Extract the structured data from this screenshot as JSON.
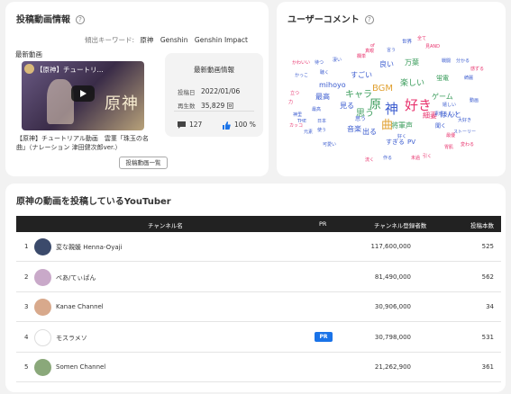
{
  "info": {
    "title": "投稿動画情報",
    "keywords_label": "傾出キーワード:",
    "keywords": [
      "原神",
      "Genshin",
      "Genshin Impact"
    ],
    "latest_label": "最新動画",
    "thumb_title": "【原神】チュートリ...",
    "thumb_logo": "原神",
    "video_title": "【原神】チュートリアル動画　雲菫「珠玉の名曲」（ナレーション 津田健次郎ver.）",
    "stats_title": "最新動画情報",
    "post_date_label": "投稿日",
    "post_date": "2022/01/06",
    "views_label": "再生数",
    "views": "35,829 回",
    "comments": "127",
    "like_ratio": "100 %",
    "list_button": "投稿動画一覧"
  },
  "cloud": {
    "title": "ユーザーコメント",
    "words": [
      {
        "t": "好き",
        "c": "#e8336d",
        "s": 15
      },
      {
        "t": "神",
        "c": "#3a5bcf",
        "s": 15
      },
      {
        "t": "原",
        "c": "#3a9c5b",
        "s": 13
      },
      {
        "t": "曲",
        "c": "#e0a030",
        "s": 13
      },
      {
        "t": "BGM",
        "c": "#e0a030",
        "s": 10
      },
      {
        "t": "キャラ",
        "c": "#3a9c5b",
        "s": 10
      },
      {
        "t": "思う",
        "c": "#3a9c5b",
        "s": 10
      },
      {
        "t": "楽しい",
        "c": "#3a9c5b",
        "s": 9
      },
      {
        "t": "万葉",
        "c": "#3a9c5b",
        "s": 8
      },
      {
        "t": "良い",
        "c": "#3a5bcf",
        "s": 8
      },
      {
        "t": "すごい",
        "c": "#3a5bcf",
        "s": 8
      },
      {
        "t": "ゲーム",
        "c": "#3a9c5b",
        "s": 8
      },
      {
        "t": "細妻",
        "c": "#e8336d",
        "s": 8
      },
      {
        "t": "ほんと",
        "c": "#3a5bcf",
        "s": 8
      },
      {
        "t": "将軍声",
        "c": "#3a9c5b",
        "s": 8
      },
      {
        "t": "mihoyo",
        "c": "#3a5bcf",
        "s": 8
      },
      {
        "t": "最高",
        "c": "#3a5bcf",
        "s": 8
      },
      {
        "t": "見る",
        "c": "#3a5bcf",
        "s": 8
      },
      {
        "t": "音楽",
        "c": "#3a5bcf",
        "s": 8
      },
      {
        "t": "出る",
        "c": "#3a5bcf",
        "s": 8
      },
      {
        "t": "すぎる",
        "c": "#3a5bcf",
        "s": 7
      },
      {
        "t": "PV",
        "c": "#3a5bcf",
        "s": 7
      },
      {
        "t": "蛍電",
        "c": "#3a9c5b",
        "s": 7
      },
      {
        "t": "聞く",
        "c": "#3a5bcf",
        "s": 6
      },
      {
        "t": "思う",
        "c": "#3a5bcf",
        "s": 6
      },
      {
        "t": "世界",
        "c": "#3a5bcf",
        "s": 5.5
      },
      {
        "t": "全て",
        "c": "#e8336d",
        "s": 5
      },
      {
        "t": "見AND",
        "c": "#e8336d",
        "s": 5
      },
      {
        "t": "真眼",
        "c": "#e8336d",
        "s": 5
      },
      {
        "t": "of",
        "c": "#e8336d",
        "s": 5
      },
      {
        "t": "言う",
        "c": "#3a5bcf",
        "s": 5
      },
      {
        "t": "待つ",
        "c": "#3a5bcf",
        "s": 5
      },
      {
        "t": "凄い",
        "c": "#3a5bcf",
        "s": 5
      },
      {
        "t": "かわいい",
        "c": "#e8336d",
        "s": 5
      },
      {
        "t": "聴く",
        "c": "#3a5bcf",
        "s": 5
      },
      {
        "t": "かっこ",
        "c": "#3a5bcf",
        "s": 5
      },
      {
        "t": "戦闘",
        "c": "#3a5bcf",
        "s": 5
      },
      {
        "t": "分かる",
        "c": "#3a5bcf",
        "s": 5
      },
      {
        "t": "感ずる",
        "c": "#e8336d",
        "s": 5
      },
      {
        "t": "綺麗",
        "c": "#3a5bcf",
        "s": 5
      },
      {
        "t": "嬉しい",
        "c": "#3a5bcf",
        "s": 5
      },
      {
        "t": "素晴らしい",
        "c": "#3a5bcf",
        "s": 5
      },
      {
        "t": "動画",
        "c": "#3a5bcf",
        "s": 5
      },
      {
        "t": "大好き",
        "c": "#3a5bcf",
        "s": 5
      },
      {
        "t": "ストーリー",
        "c": "#3a5bcf",
        "s": 5
      },
      {
        "t": "神里",
        "c": "#3a5bcf",
        "s": 5
      },
      {
        "t": "最高",
        "c": "#3a5bcf",
        "s": 5
      },
      {
        "t": "THE",
        "c": "#3a5bcf",
        "s": 5
      },
      {
        "t": "日本",
        "c": "#3a5bcf",
        "s": 5
      },
      {
        "t": "元素",
        "c": "#3a5bcf",
        "s": 5
      },
      {
        "t": "使う",
        "c": "#3a5bcf",
        "s": 5
      },
      {
        "t": "カッコ",
        "c": "#e8336d",
        "s": 5
      },
      {
        "t": "可愛い",
        "c": "#3a5bcf",
        "s": 5
      },
      {
        "t": "好く",
        "c": "#3a5bcf",
        "s": 5
      },
      {
        "t": "作る",
        "c": "#3a5bcf",
        "s": 5
      },
      {
        "t": "未過",
        "c": "#e8336d",
        "s": 5
      },
      {
        "t": "引く",
        "c": "#e8336d",
        "s": 5
      },
      {
        "t": "変わる",
        "c": "#e8336d",
        "s": 5
      },
      {
        "t": "最優",
        "c": "#e8336d",
        "s": 5
      },
      {
        "t": "立つ",
        "c": "#e8336d",
        "s": 5
      },
      {
        "t": "力",
        "c": "#e8336d",
        "s": 5
      },
      {
        "t": "流く",
        "c": "#e8336d",
        "s": 5
      },
      {
        "t": "欄単",
        "c": "#e8336d",
        "s": 5
      },
      {
        "t": "胃肌",
        "c": "#e8336d",
        "s": 5
      }
    ]
  },
  "table": {
    "title": "原神の動画を投稿しているYouTuber",
    "columns": [
      "チャンネル名",
      "PR",
      "チャンネル登録者数",
      "投稿本数"
    ],
    "rows": [
      {
        "rank": "1",
        "name": "変な親媛 Henna-Oyaji",
        "pr": "",
        "subs": "117,600,000",
        "videos": "525",
        "avatar": "#3b4a6b"
      },
      {
        "rank": "2",
        "name": "ぺあ/てぃばん",
        "pr": "",
        "subs": "81,490,000",
        "videos": "562",
        "avatar": "#c9a9c9"
      },
      {
        "rank": "3",
        "name": "Kanae Channel",
        "pr": "",
        "subs": "30,906,000",
        "videos": "34",
        "avatar": "#d8a98c"
      },
      {
        "rank": "4",
        "name": "モスラメソ",
        "pr": "PR",
        "subs": "30,798,000",
        "videos": "531",
        "avatar": "#ffffff"
      },
      {
        "rank": "5",
        "name": "Somen Channel",
        "pr": "",
        "subs": "21,262,900",
        "videos": "361",
        "avatar": "#8aa87a"
      }
    ]
  }
}
